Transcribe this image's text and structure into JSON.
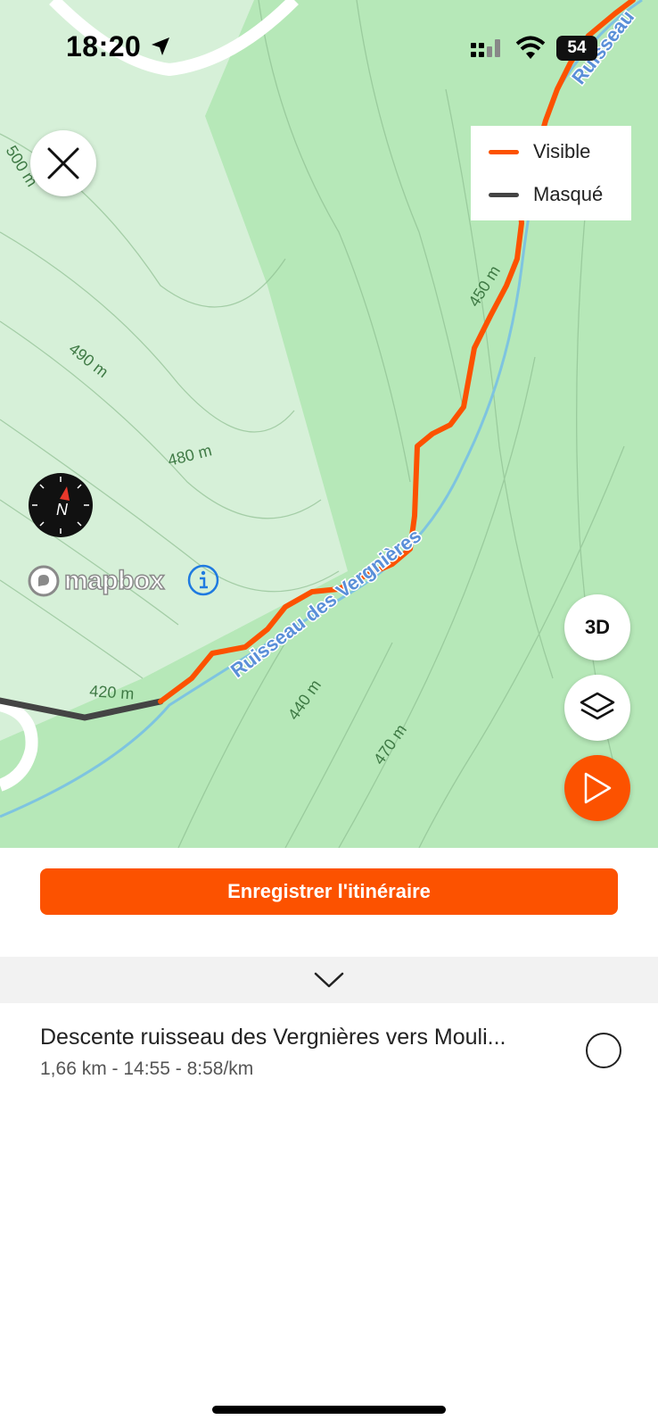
{
  "status_bar": {
    "time": "18:20",
    "battery": "54"
  },
  "legend": {
    "items": [
      {
        "label": "Visible",
        "color": "#fc5200"
      },
      {
        "label": "Masqué",
        "color": "#444444"
      }
    ]
  },
  "map": {
    "contour_labels": [
      "500 m",
      "490 m",
      "480 m",
      "450 m",
      "420 m",
      "440 m",
      "470 m"
    ],
    "stream_labels": [
      "Ruisseau des Vergnières",
      "Ruisseau"
    ],
    "attribution": "mapbox",
    "compass_label": "N"
  },
  "controls": {
    "three_d_label": "3D"
  },
  "actions": {
    "save_route_label": "Enregistrer l'itinéraire"
  },
  "route": {
    "title": "Descente ruisseau des Vergnières vers Mouli...",
    "stats": "1,66 km - 14:55 - 8:58/km"
  },
  "colors": {
    "accent": "#fc5200",
    "map_green": "#b6e8b8",
    "water": "#7ec4e0"
  }
}
